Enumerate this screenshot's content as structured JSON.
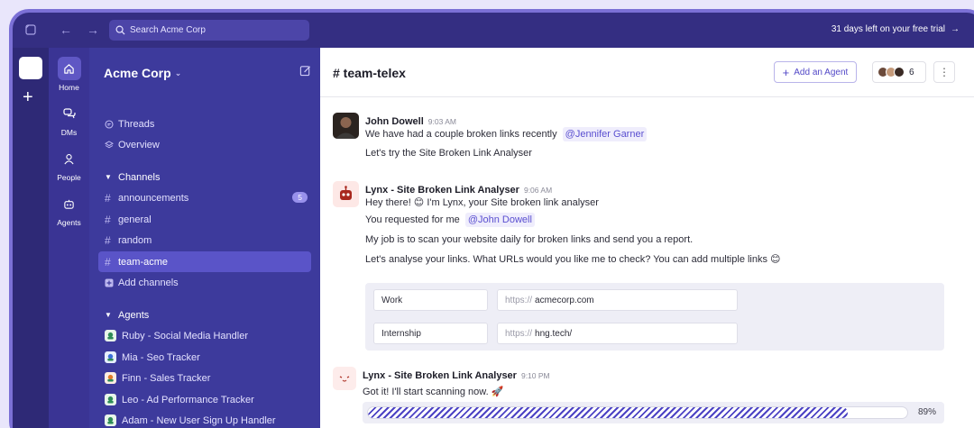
{
  "topbar": {
    "search_placeholder": "Search Acme Corp",
    "trial_text": "31 days left on your free trial"
  },
  "nav": {
    "home": "Home",
    "dms": "DMs",
    "people": "People",
    "agents": "Agents"
  },
  "sidebar": {
    "workspace": "Acme Corp",
    "threads": "Threads",
    "overview": "Overview",
    "channels_header": "Channels",
    "channels": [
      {
        "name": "announcements",
        "badge": "5"
      },
      {
        "name": "general"
      },
      {
        "name": "random"
      },
      {
        "name": "team-acme"
      }
    ],
    "add_channels": "Add channels",
    "agents_header": "Agents",
    "agents": [
      {
        "name": "Ruby - Social Media Handler",
        "color": "#2e8b57"
      },
      {
        "name": "Mia - Seo Tracker",
        "color": "#3b6fd8"
      },
      {
        "name": "Finn - Sales Tracker",
        "color": "#e07b2a"
      },
      {
        "name": "Leo - Ad Performance Tracker",
        "color": "#2e8b57"
      },
      {
        "name": "Adam - New User Sign Up Handler",
        "color": "#2e8b57"
      }
    ]
  },
  "channel": {
    "title": "# team-telex",
    "add_agent": "Add an Agent",
    "member_count": "6"
  },
  "messages": {
    "m1": {
      "name": "John Dowell",
      "time": "9:03 AM",
      "line1": "We have had a couple broken links recently",
      "mention1": "@Jennifer Garner",
      "line2": "Let's try the Site Broken Link Analyser"
    },
    "m2": {
      "name": "Lynx - Site Broken Link Analyser",
      "time": "9:06 AM",
      "line1": "Hey there! 😊 I'm Lynx, your Site broken link analyser",
      "line2": "You requested for me",
      "mention2": "@John Dowell",
      "line3": "My job is to scan your website daily for broken links and send you a report.",
      "line4": "Let's analyse your links. What URLs would you like me to check? You can add multiple links 😊",
      "form": [
        {
          "label": "Work",
          "prefix": "https://",
          "value": "acmecorp.com"
        },
        {
          "label": "Internship",
          "prefix": "https://",
          "value": "hng.tech/"
        }
      ]
    },
    "m3": {
      "name": "Lynx - Site Broken Link Analyser",
      "time": "9:10 PM",
      "line1": "Got it! I'll start scanning now. 🚀",
      "progress": 0.89,
      "progress_label": "89%"
    }
  }
}
